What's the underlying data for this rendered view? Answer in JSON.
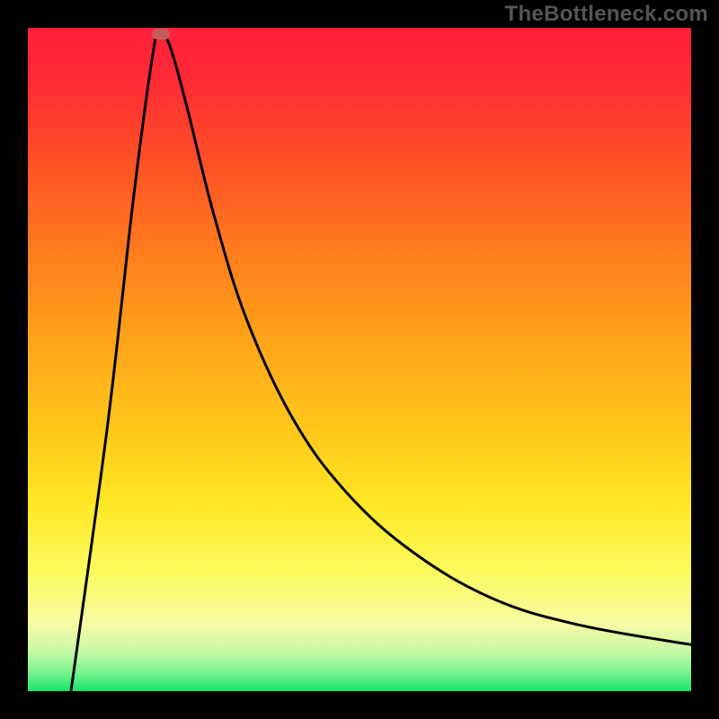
{
  "watermark": "TheBottleneck.com",
  "colors": {
    "frame": "#000000",
    "curve": "#000000",
    "marker": "#c45a5a",
    "gradient_stops": [
      "#ff1f3a",
      "#ff2b35",
      "#ff5026",
      "#ff7a1e",
      "#ffa119",
      "#ffc61a",
      "#ffe826",
      "#fbfb5e",
      "#f6fba4",
      "#c7f9a6",
      "#7ef58f",
      "#18e46b"
    ]
  },
  "chart_data": {
    "type": "line",
    "title": "",
    "xlabel": "",
    "ylabel": "",
    "xlim": [
      0,
      100
    ],
    "ylim": [
      0,
      100
    ],
    "marker": {
      "x": 20,
      "y": 99
    },
    "series": [
      {
        "name": "curve",
        "points": [
          {
            "x": 6.5,
            "y": 0
          },
          {
            "x": 12.0,
            "y": 40
          },
          {
            "x": 16.0,
            "y": 75
          },
          {
            "x": 19.0,
            "y": 97
          },
          {
            "x": 20.0,
            "y": 99
          },
          {
            "x": 21.5,
            "y": 97
          },
          {
            "x": 24.0,
            "y": 88
          },
          {
            "x": 28.0,
            "y": 72
          },
          {
            "x": 33.0,
            "y": 56
          },
          {
            "x": 40.0,
            "y": 41
          },
          {
            "x": 48.0,
            "y": 30
          },
          {
            "x": 58.0,
            "y": 21
          },
          {
            "x": 70.0,
            "y": 14
          },
          {
            "x": 83.0,
            "y": 10
          },
          {
            "x": 100.0,
            "y": 7
          }
        ]
      }
    ]
  }
}
